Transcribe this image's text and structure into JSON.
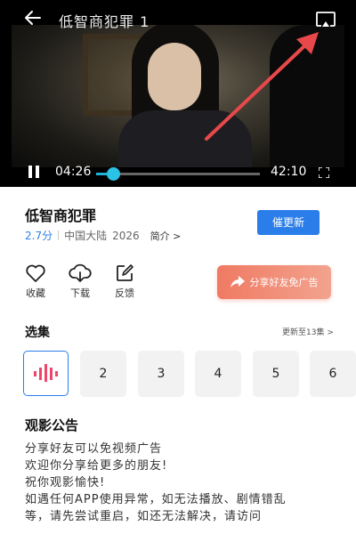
{
  "player": {
    "title": "低智商犯罪 1",
    "current_time": "04:26",
    "total_time": "42:10",
    "progress_fraction": 0.105,
    "accent_color": "#1fb2d6",
    "icons": [
      "back-arrow-icon",
      "cast-screen-icon",
      "pause-icon",
      "fullscreen-icon"
    ]
  },
  "info": {
    "title": "低智商犯罪",
    "score": "2.7分",
    "region": "中国大陆",
    "year": "2026",
    "intro_link": "简介 >",
    "update_button": "催更新",
    "update_button_color": "#2b7de9"
  },
  "actions": {
    "favorite": {
      "label": "收藏",
      "icon": "heart-icon"
    },
    "download": {
      "label": "下载",
      "icon": "cloud-download-icon"
    },
    "feedback": {
      "label": "反馈",
      "icon": "edit-icon"
    },
    "share": {
      "label": "分享好友免广告",
      "icon": "share-arrow-icon"
    }
  },
  "episodes": {
    "label": "选集",
    "more": "更新至13集 >",
    "playing_icon": "playing-bars-icon",
    "items": [
      "2",
      "3",
      "4",
      "5",
      "6"
    ]
  },
  "notice": {
    "title": "观影公告",
    "lines": [
      "分享好友可以免视频广告",
      "欢迎你分享给更多的朋友!",
      "祝你观影愉快!",
      "如遇任何APP使用异常，如无法播放、剧情错乱",
      "等，请先尝试重启，如还无法解决，请访问"
    ]
  }
}
